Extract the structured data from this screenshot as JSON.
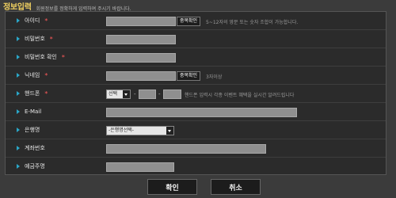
{
  "header": {
    "title": "정보입력",
    "subtitle": "회원정보를 정확하게 입력하여 주시기 바랍니다."
  },
  "form": {
    "rows": [
      {
        "label": "아이디",
        "required": "*",
        "button": "중복확인",
        "hint": "5~12자의 영문 또는 숫자 조합이 가능합니다."
      },
      {
        "label": "비밀번호",
        "required": "*"
      },
      {
        "label": "비밀번호 확인",
        "required": "*"
      },
      {
        "label": "닉네임",
        "required": "*",
        "button": "중복확인",
        "hint": "3자이상"
      },
      {
        "label": "핸드폰",
        "required": "*",
        "select": "선택",
        "sep1": "-",
        "sep2": "-",
        "hint": "핸드폰 입력시 각종 이벤트 혜택을 실시간 알려드립니다"
      },
      {
        "label": "E-Mail"
      },
      {
        "label": "은행명",
        "select": "-은행명선택-"
      },
      {
        "label": "계좌번호"
      },
      {
        "label": "예금주명"
      }
    ]
  },
  "actions": {
    "confirm": "확인",
    "cancel": "취소"
  }
}
